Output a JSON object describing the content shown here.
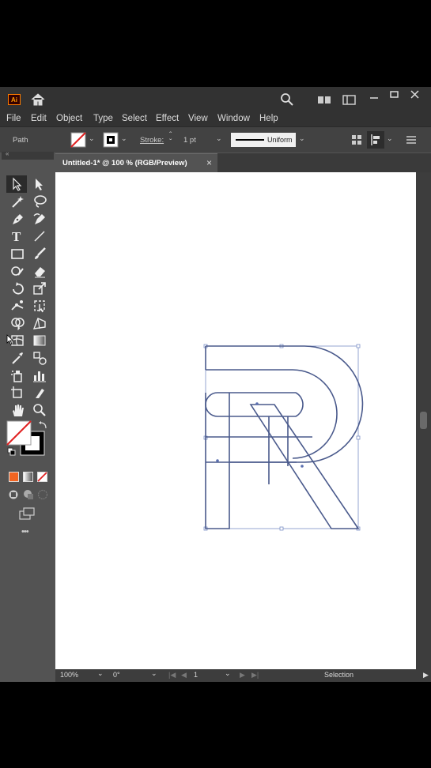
{
  "app": {
    "logo_text": "Ai"
  },
  "menu": [
    "File",
    "Edit",
    "Object",
    "Type",
    "Select",
    "Effect",
    "View",
    "Window",
    "Help"
  ],
  "control_bar": {
    "selection_type": "Path",
    "stroke_label": "Stroke:",
    "stroke_weight": "1 pt",
    "profile": "Uniform"
  },
  "document_tab": {
    "title": "Untitled-1* @ 100 % (RGB/Preview)",
    "close": "×"
  },
  "toolbar_more": "•••",
  "status_bar": {
    "zoom": "100%",
    "rotation": "0°",
    "artboard": "1",
    "tool": "Selection"
  },
  "colors": {
    "app_bg": "#535353",
    "dark_bar": "#323232",
    "path_stroke": "#4a5a8c",
    "accent_orange": "#ff7c00"
  }
}
